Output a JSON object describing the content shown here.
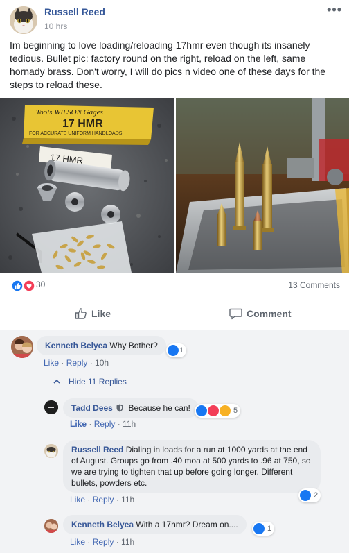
{
  "post": {
    "author": "Russell Reed",
    "time": "10 hrs",
    "more_icon": "more-dots-icon",
    "text": "Im beginning to love loading/reloading 17hmr even though its insanely tedious. Bullet pic: factory round on the right, reload on the left, same hornady brass. Don't worry, I will do pics n video one of these days for the steps to reload these.",
    "photo_left_box_text_1": "Tools WILSON Gages",
    "photo_left_box_text_2": "17 HMR",
    "photo_left_box_text_3": "FOR ACCURATE UNIFORM HANDLOADS",
    "photo_left_box_text_4": "17 HMR"
  },
  "reactions": {
    "count": "30",
    "comments": "13 Comments",
    "colors": {
      "like": "#1877f2",
      "love": "#f33e58",
      "haha": "#f7b125"
    }
  },
  "actions": {
    "like_label": "Like",
    "comment_label": "Comment"
  },
  "comments": {
    "c1": {
      "name": "Kenneth Belyea",
      "text": "Why Bother?",
      "like": "Like",
      "reply": "Reply",
      "time": "10h",
      "reaction_count": "1"
    },
    "hide_replies": "Hide 11 Replies",
    "r1": {
      "name": "Tadd Dees",
      "text": "Because he can!",
      "like": "Like",
      "reply": "Reply",
      "time": "11h",
      "reaction_count": "5"
    },
    "r2": {
      "name": "Russell Reed",
      "text": "Dialing in loads for a run at 1000 yards at the end of August. Groups go from .40 moa at 500 yards to .96 at 750, so we are trying to tighten that up before going longer. Different bullets, powders etc.",
      "like": "Like",
      "reply": "Reply",
      "time": "11h",
      "reaction_count": "2"
    },
    "r3": {
      "name": "Kenneth Belyea",
      "text": "With a 17hmr? Dream on....",
      "like": "Like",
      "reply": "Reply",
      "time": "11h",
      "reaction_count": "1"
    },
    "separator": " · "
  }
}
